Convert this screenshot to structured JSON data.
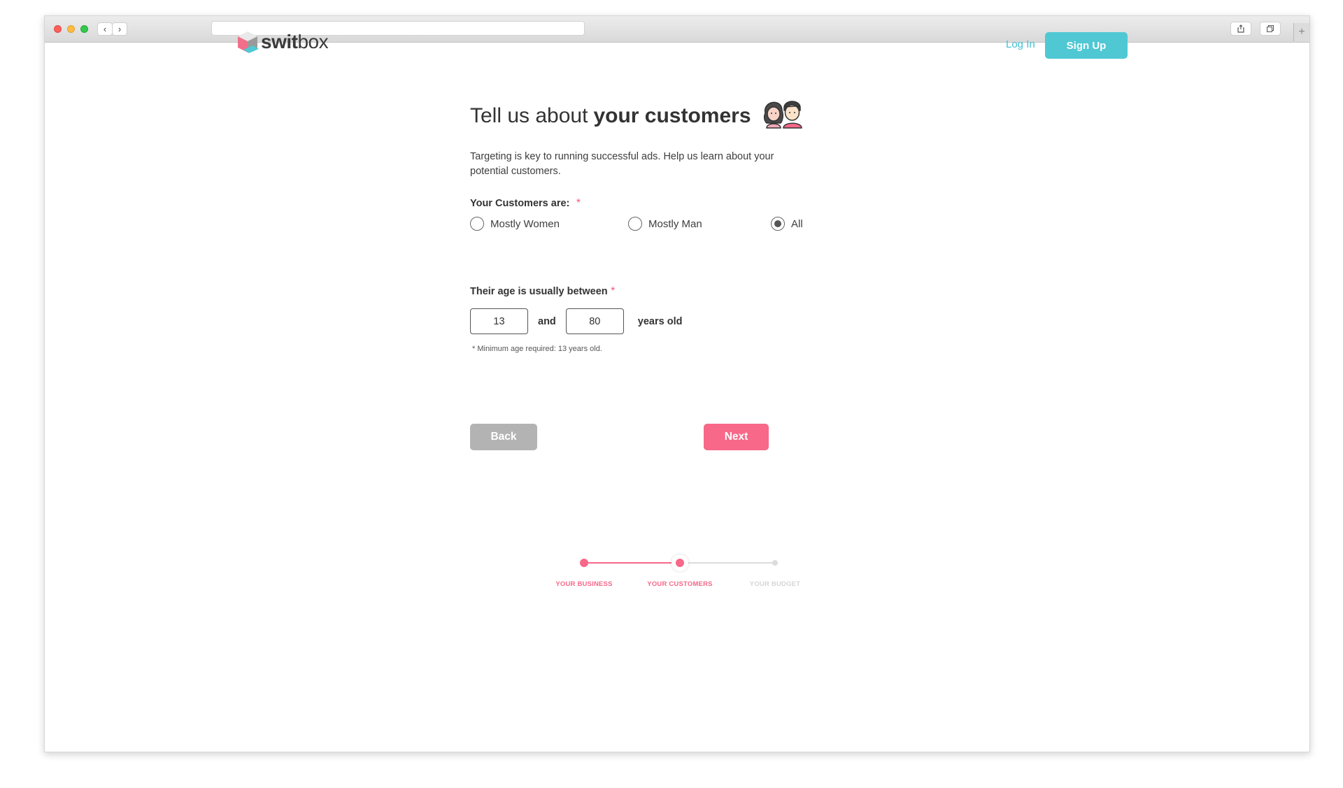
{
  "brand": {
    "logo_text_bold": "swit",
    "logo_text_regular": "box",
    "logo_colors": [
      "#f06f8a",
      "#4fc8d4",
      "#9a9a9a",
      "#e9e9e9"
    ]
  },
  "header": {
    "login_label": "Log In",
    "signup_label": "Sign Up",
    "accent_color": "#4fc8d4"
  },
  "main": {
    "title_regular": "Tell us about",
    "title_bold": "your customers",
    "intro": "Targeting is key to running successful ads. Help us learn about your potential customers.",
    "customers_label": "Your Customers are:",
    "required_mark": "*",
    "options": [
      {
        "label": "Mostly Women",
        "selected": false
      },
      {
        "label": "Mostly Man",
        "selected": false
      },
      {
        "label": "All",
        "selected": true
      }
    ],
    "age_label": "Their age is usually between",
    "age_min": "13",
    "and_label": "and",
    "age_max": "80",
    "years_label": "years old",
    "note": "* Minimum age required: 13 years old."
  },
  "actions": {
    "back_label": "Back",
    "next_label": "Next"
  },
  "steps": [
    {
      "label": "YOUR BUSINESS",
      "state": "done"
    },
    {
      "label": "YOUR CUSTOMERS",
      "state": "current"
    },
    {
      "label": "YOUR BUDGET",
      "state": "upcoming"
    }
  ],
  "colors": {
    "pink": "#f76889",
    "grey_button": "#b3b3b3",
    "inactive": "#dcdcdc"
  }
}
